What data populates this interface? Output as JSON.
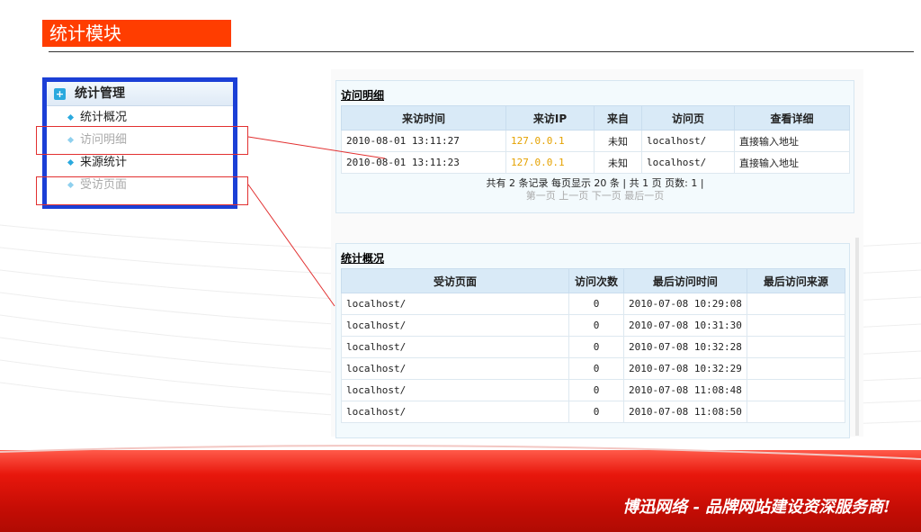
{
  "page_title": "统计模块",
  "menu": {
    "header": "统计管理",
    "items": [
      {
        "label": "统计概况"
      },
      {
        "label": "访问明细"
      },
      {
        "label": "来源统计"
      },
      {
        "label": "受访页面"
      }
    ]
  },
  "detail": {
    "title": "访问明细",
    "headers": [
      "来访时间",
      "来访IP",
      "来自",
      "访问页",
      "查看详细"
    ],
    "rows": [
      [
        "2010-08-01 13:11:27",
        "127.0.0.1",
        "未知",
        "localhost/",
        "直接输入地址"
      ],
      [
        "2010-08-01 13:11:23",
        "127.0.0.1",
        "未知",
        "localhost/",
        "直接输入地址"
      ]
    ],
    "pager_line": "共有 2 条记录 每页显示 20 条 | 共 1 页 页数: 1 |",
    "pager_links": "第一页 上一页 下一页 最后一页"
  },
  "summary": {
    "title": "统计概况",
    "headers": [
      "受访页面",
      "访问次数",
      "最后访问时间",
      "最后访问来源"
    ],
    "rows": [
      [
        "localhost/",
        "0",
        "2010-07-08 10:29:08",
        ""
      ],
      [
        "localhost/",
        "0",
        "2010-07-08 10:31:30",
        ""
      ],
      [
        "localhost/",
        "0",
        "2010-07-08 10:32:28",
        ""
      ],
      [
        "localhost/",
        "0",
        "2010-07-08 10:32:29",
        ""
      ],
      [
        "localhost/",
        "0",
        "2010-07-08 11:08:48",
        ""
      ],
      [
        "localhost/",
        "0",
        "2010-07-08 11:08:50",
        ""
      ]
    ]
  },
  "slogan": "博迅网络 - 品牌网站建设资深服务商!",
  "colors": {
    "accent": "#ff3d00",
    "menu_border": "#1b3fd6",
    "ip_text": "#e5a200",
    "band": "#d0120a"
  }
}
